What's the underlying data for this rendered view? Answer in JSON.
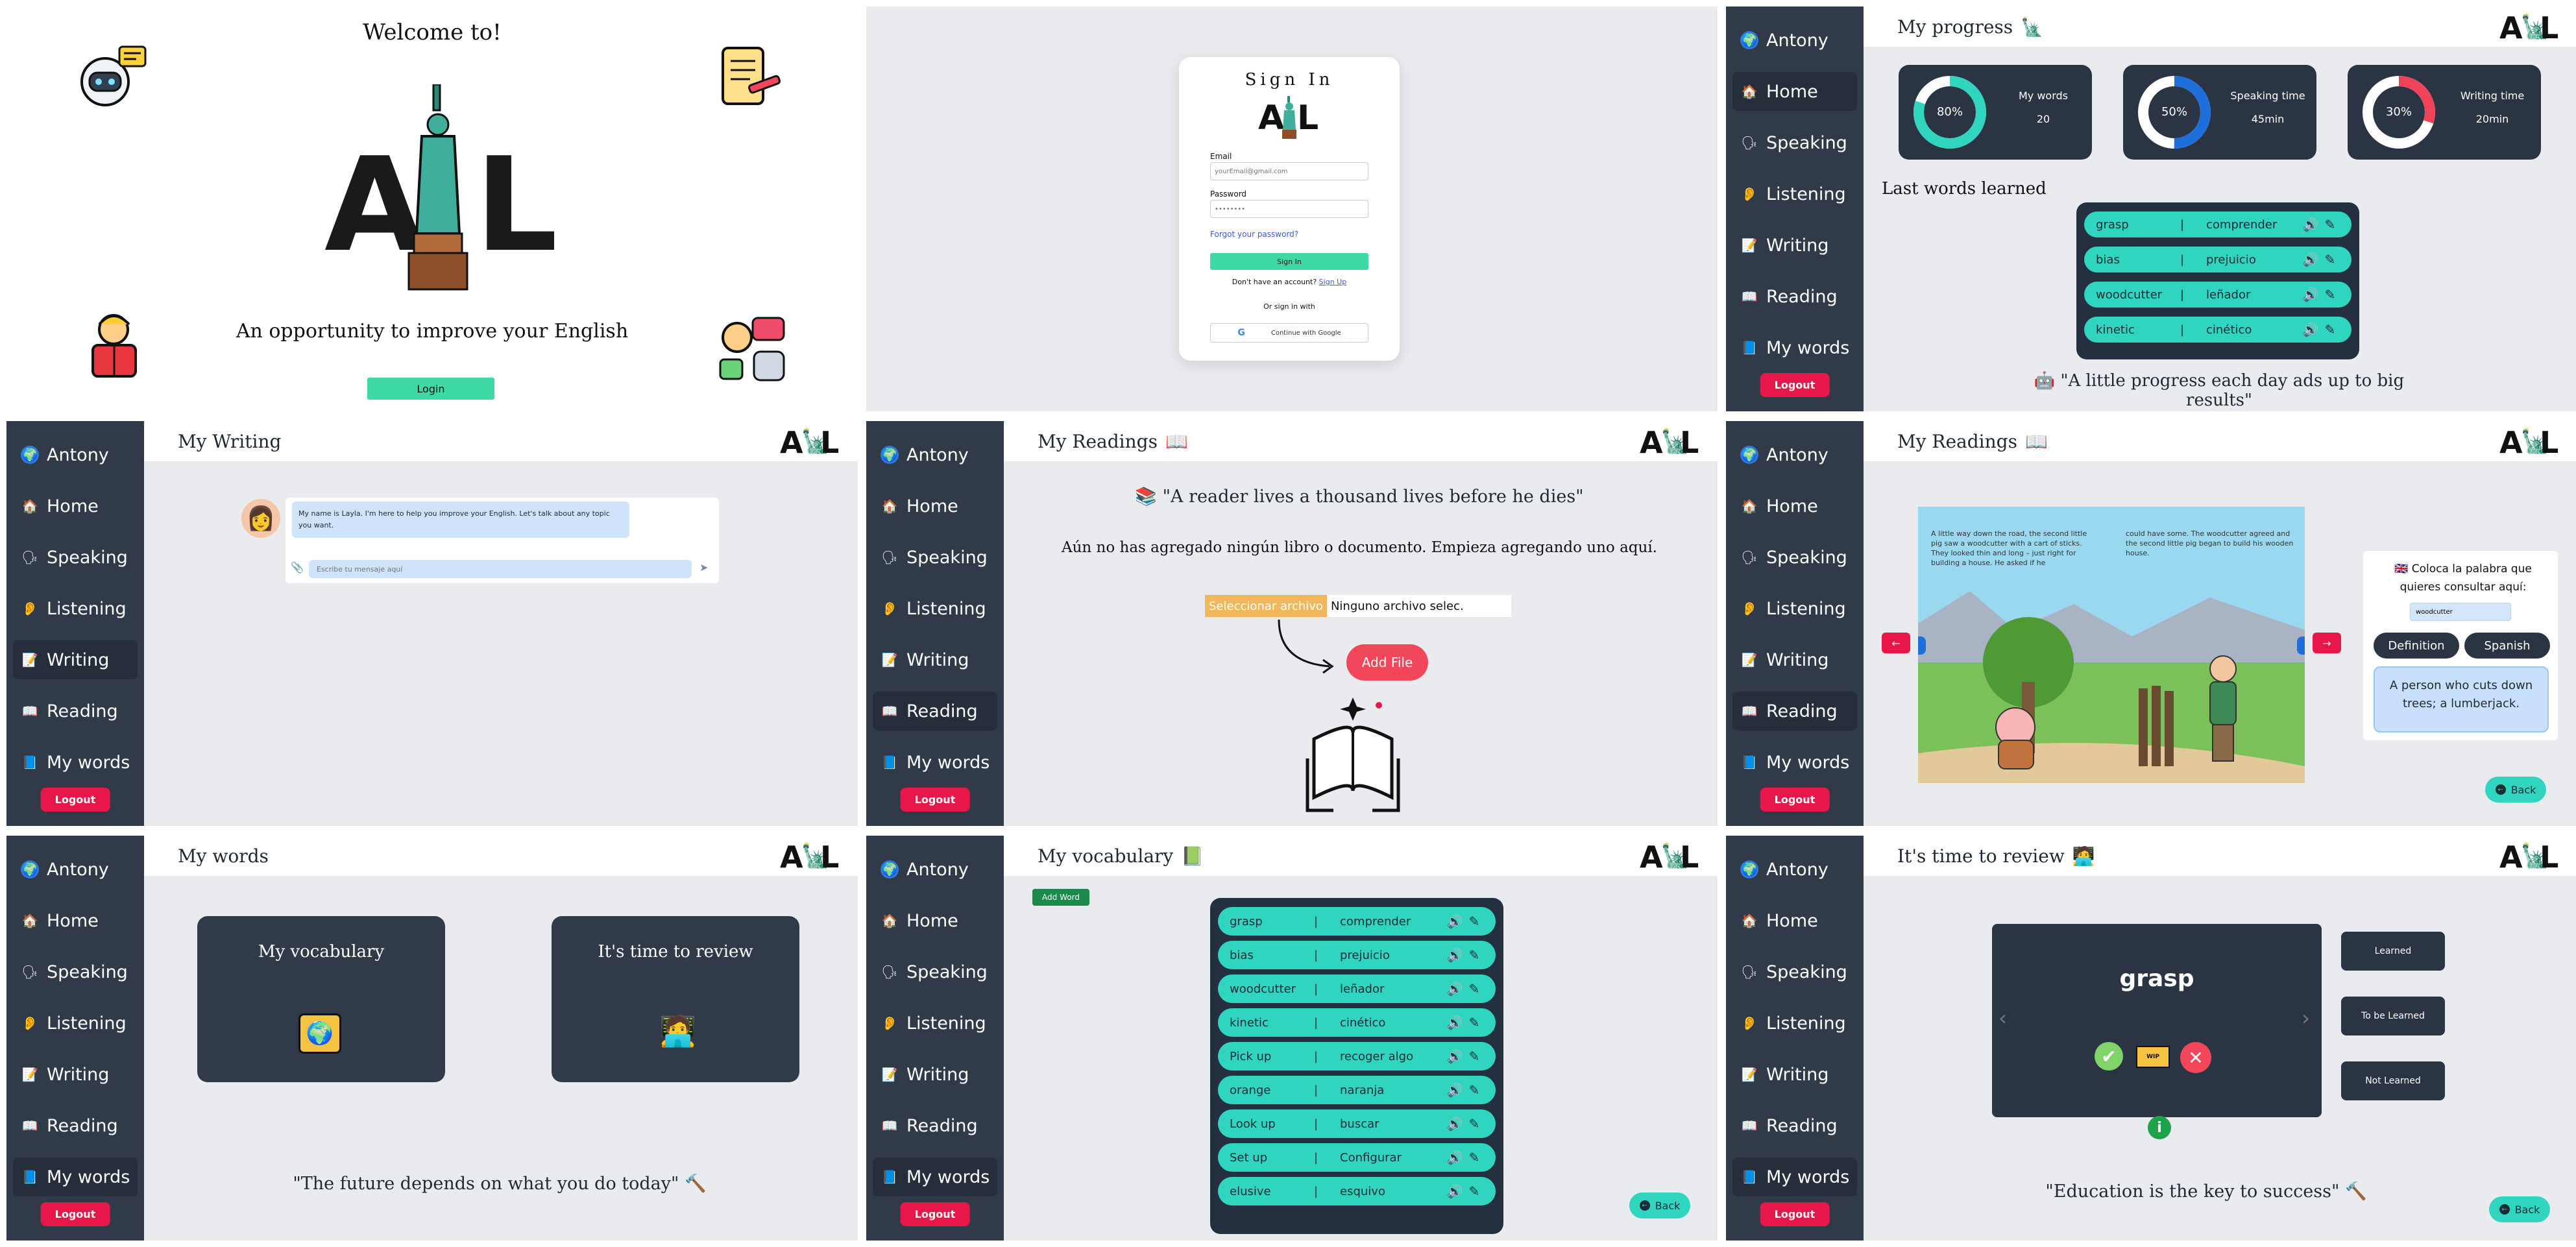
{
  "colors": {
    "sidebar": "#303a48",
    "accent": "#2fd5be",
    "login_green": "#3fd9a6",
    "danger": "#e8174a",
    "bg": "#e9ebee"
  },
  "brand": {
    "logo_left": "A",
    "logo_right": "L"
  },
  "sidebar": {
    "user": "Antony",
    "items": [
      "Home",
      "Speaking",
      "Listening",
      "Writing",
      "Reading",
      "My words"
    ],
    "logout": "Logout"
  },
  "welcome": {
    "title": "Welcome to!",
    "tagline": "An opportunity to improve your English",
    "login": "Login"
  },
  "signin": {
    "title": "Sign In",
    "email_label": "Email",
    "email_placeholder": "yourEmail@gmail.com",
    "password_label": "Password",
    "password_placeholder": "••••••••",
    "forgot": "Forgot your password?",
    "button": "Sign In",
    "no_account": "Don't have an account?",
    "signup": "Sign Up",
    "or": "Or sign in with",
    "google": "Continue with Google"
  },
  "progress": {
    "title": "My progress",
    "cards": [
      {
        "pct": "80%",
        "label": "My words",
        "value": "20",
        "color": "#2fd5be",
        "frac": 0.8
      },
      {
        "pct": "50%",
        "label": "Speaking time",
        "value": "45min",
        "color": "#1e6fd9",
        "frac": 0.5
      },
      {
        "pct": "30%",
        "label": "Writing time",
        "value": "20min",
        "color": "#f0435a",
        "frac": 0.3
      }
    ],
    "last_title": "Last words learned",
    "quote": "\"A little progress each day ads up to big results\""
  },
  "words_short": [
    {
      "en": "grasp",
      "es": "comprender"
    },
    {
      "en": "bias",
      "es": "prejuicio"
    },
    {
      "en": "woodcutter",
      "es": "leñador"
    },
    {
      "en": "kinetic",
      "es": "cinético"
    }
  ],
  "writing": {
    "title": "My Writing",
    "bot_msg": "My name is Layla. I'm here to help you improve your English. Let's talk about any topic you want.",
    "input_placeholder": "Escribe tu mensaje aquí"
  },
  "readings": {
    "title": "My Readings",
    "quote": "\"A reader lives a thousand lives before he dies\"",
    "empty": "Aún no has agregado ningún libro o documento. Empieza agregando uno aquí.",
    "select_file": "Seleccionar archivo",
    "no_file": "Ninguno archivo selec.",
    "add_file": "Add File"
  },
  "reader": {
    "title": "My Readings",
    "page_left": "A little way down the road, the second little pig saw a woodcutter with a cart of sticks. They looked thin and long – just right for building a house. He asked if he",
    "page_right": "could have some. The woodcutter agreed and the second little pig began to build his wooden house.",
    "place_word": "Coloca la palabra que quieres consultar aquí:",
    "word": "woodcutter",
    "definition_btn": "Definition",
    "spanish_btn": "Spanish",
    "definition": "A person who cuts down trees; a lumberjack.",
    "back": "Back",
    "prev": "←",
    "next": "→"
  },
  "mywords": {
    "title": "My words",
    "vocab": "My vocabulary",
    "review": "It's time to review",
    "quote": "\"The future depends on what you do today\""
  },
  "vocab": {
    "title": "My vocabulary",
    "add": "Add Word",
    "back": "Back",
    "words": [
      {
        "en": "grasp",
        "es": "comprender"
      },
      {
        "en": "bias",
        "es": "prejuicio"
      },
      {
        "en": "woodcutter",
        "es": "leñador"
      },
      {
        "en": "kinetic",
        "es": "cinético"
      },
      {
        "en": "Pick up",
        "es": "recoger algo"
      },
      {
        "en": "orange",
        "es": "naranja"
      },
      {
        "en": "Look up",
        "es": "buscar"
      },
      {
        "en": "Set up",
        "es": "Configurar"
      },
      {
        "en": "elusive",
        "es": "esquivo"
      }
    ]
  },
  "review": {
    "title": "It's time to review",
    "word": "grasp",
    "learned": "Learned",
    "to_learn": "To be Learned",
    "not_learned": "Not Learned",
    "quote": "\"Education is the key to success\"",
    "back": "Back",
    "prev": "‹",
    "next": "›"
  }
}
